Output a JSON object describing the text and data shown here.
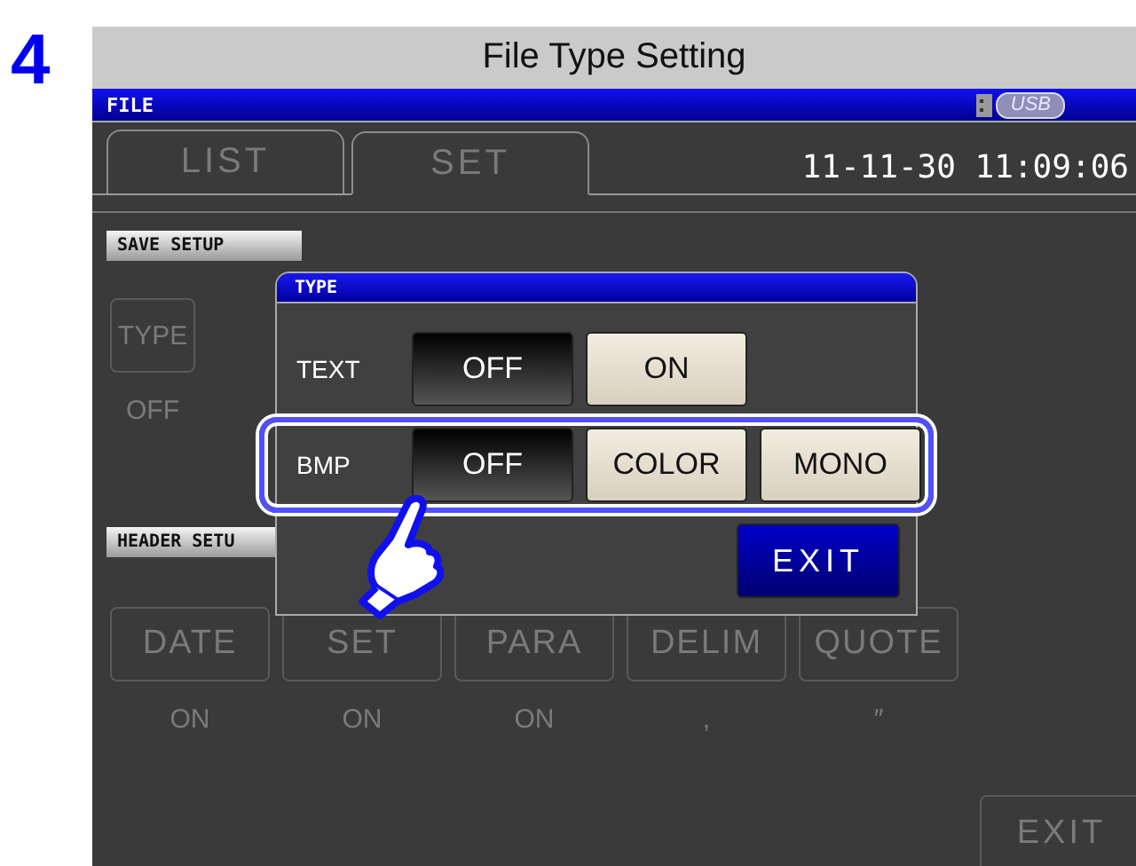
{
  "step": "4",
  "title": "File Type Setting",
  "status_bar": {
    "label": "FILE",
    "usb": "USB"
  },
  "tabs": [
    {
      "label": "LIST",
      "selected": false
    },
    {
      "label": "SET",
      "selected": true
    }
  ],
  "datetime": "11-11-30 11:09:06",
  "save_setup": {
    "heading": "SAVE SETUP",
    "buttons": [
      {
        "label": "TYPE",
        "value": "OFF"
      }
    ]
  },
  "header_setup": {
    "heading": "HEADER SETU",
    "buttons": [
      {
        "label": "DATE",
        "value": "ON"
      },
      {
        "label": "SET",
        "value": "ON"
      },
      {
        "label": "PARA",
        "value": "ON"
      },
      {
        "label": "DELIM",
        "value": ","
      },
      {
        "label": "QUOTE",
        "value": "″"
      }
    ]
  },
  "exit": "EXIT",
  "dialog": {
    "title": "TYPE",
    "rows": [
      {
        "label": "TEXT",
        "highlighted": false,
        "options": [
          {
            "label": "OFF",
            "selected": true
          },
          {
            "label": "ON",
            "selected": false
          }
        ]
      },
      {
        "label": "BMP",
        "highlighted": true,
        "options": [
          {
            "label": "OFF",
            "selected": true
          },
          {
            "label": "COLOR",
            "selected": false
          },
          {
            "label": "MONO",
            "selected": false
          }
        ]
      }
    ],
    "exit": "EXIT"
  }
}
